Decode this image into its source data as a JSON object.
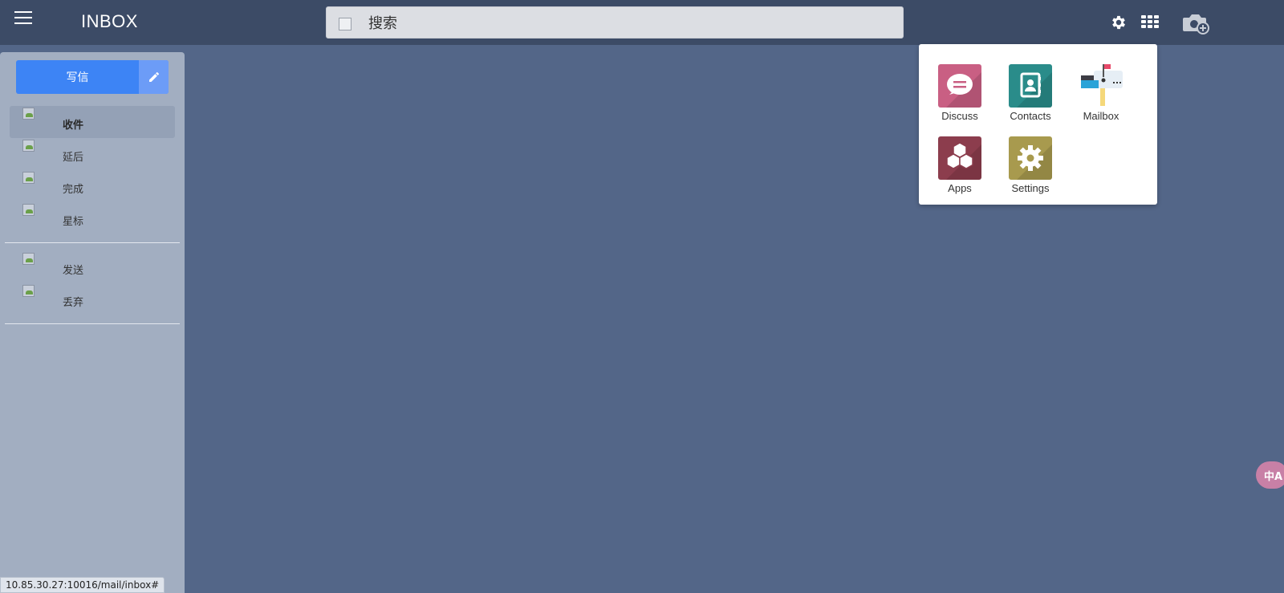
{
  "header": {
    "title": "INBOX",
    "search_placeholder": "搜索"
  },
  "sidebar": {
    "compose_label": "写信",
    "items": [
      {
        "label": "收件",
        "active": true
      },
      {
        "label": "延后"
      },
      {
        "label": "完成"
      },
      {
        "label": "星标"
      },
      {
        "label": "发送"
      },
      {
        "label": "丢弃"
      }
    ]
  },
  "app_menu": {
    "apps": [
      {
        "label": "Discuss",
        "color": "#c95f83"
      },
      {
        "label": "Contacts",
        "color": "#2a8c8a"
      },
      {
        "label": "Mailbox"
      },
      {
        "label": "Apps",
        "color": "#8c3d4d"
      },
      {
        "label": "Settings",
        "color": "#a89a4e"
      }
    ]
  },
  "status_bar": {
    "url": "10.85.30.27:10016/mail/inbox#"
  },
  "translate_button": {
    "label": "中A"
  }
}
